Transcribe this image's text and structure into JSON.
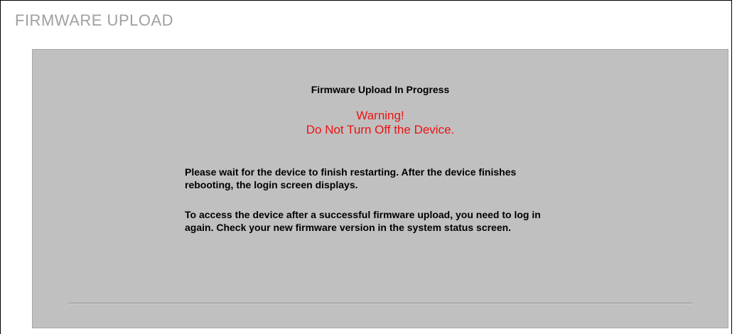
{
  "page": {
    "title": "FIRMWARE UPLOAD"
  },
  "panel": {
    "heading": "Firmware Upload In Progress",
    "warning_line1": "Warning!",
    "warning_line2": "Do Not Turn Off the Device.",
    "paragraph1": "Please wait for the device to finish restarting. After the device finishes rebooting, the login screen displays.",
    "paragraph2": "To access the device after a successful firmware upload, you need to log in again. Check your new firmware version in the system status screen."
  },
  "colors": {
    "title_gray": "#a0a0a0",
    "panel_bg": "#c0c0c0",
    "warning_red": "#ee1111",
    "frame_border": "#000000"
  }
}
